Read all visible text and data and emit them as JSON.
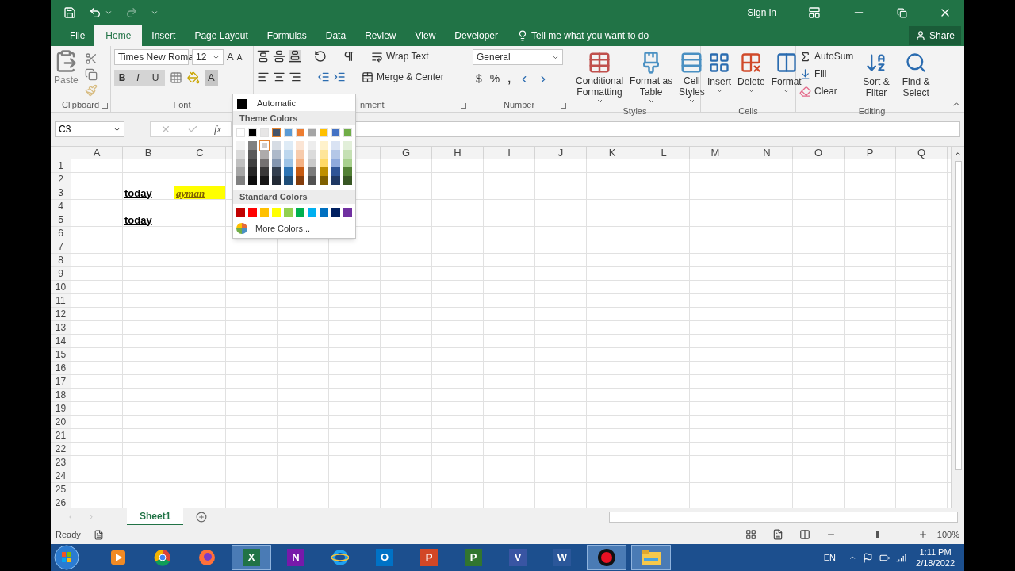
{
  "title_bar": {
    "sign_in": "Sign in"
  },
  "tabs": [
    {
      "label": "File",
      "selected": false
    },
    {
      "label": "Home",
      "selected": true
    },
    {
      "label": "Insert",
      "selected": false
    },
    {
      "label": "Page Layout",
      "selected": false
    },
    {
      "label": "Formulas",
      "selected": false
    },
    {
      "label": "Data",
      "selected": false
    },
    {
      "label": "Review",
      "selected": false
    },
    {
      "label": "View",
      "selected": false
    },
    {
      "label": "Developer",
      "selected": false
    }
  ],
  "tell_me": "Tell me what you want to do",
  "share": "Share",
  "ribbon": {
    "clipboard": {
      "paste": "Paste",
      "label": "Clipboard"
    },
    "font": {
      "font_name": "Times New Roma",
      "font_size": "12",
      "grow": "A",
      "shrink": "A",
      "bold": "B",
      "italic": "I",
      "underline": "U",
      "font_color": "A",
      "font_color_open": true,
      "label": "Font"
    },
    "alignment": {
      "wrap_text": "Wrap Text",
      "merge": "Merge & Center",
      "label": "nment"
    },
    "number": {
      "format": "General",
      "currency": "$",
      "percent": "%",
      "comma": ",",
      "label": "Number"
    },
    "styles": {
      "items": [
        {
          "lines": [
            "Conditional",
            "Formatting"
          ]
        },
        {
          "lines": [
            "Format as",
            "Table"
          ]
        },
        {
          "lines": [
            "Cell",
            "Styles"
          ]
        }
      ],
      "label": "Styles"
    },
    "cells": {
      "items": [
        "Insert",
        "Delete",
        "Format"
      ],
      "label": "Cells"
    },
    "editing": {
      "autosum": "AutoSum",
      "fill": "Fill",
      "clear": "Clear",
      "sort": [
        "Sort &",
        "Filter"
      ],
      "find": [
        "Find &",
        "Select"
      ],
      "label": "Editing"
    }
  },
  "formula_bar": {
    "name_box": "C3",
    "fx": "fx"
  },
  "sheet": {
    "columns": [
      "A",
      "B",
      "C",
      null,
      null,
      null,
      "G",
      "H",
      "I",
      "J",
      "K",
      "L",
      "M",
      "N",
      "O",
      "P",
      "Q"
    ],
    "rows": [
      {
        "label": "1",
        "cells": []
      },
      {
        "label": "2",
        "cells": []
      },
      {
        "label": "3",
        "cells": [
          "",
          {
            "text": "today",
            "serif": false,
            "bold": true,
            "italic": false,
            "underline": true,
            "highlight": false
          },
          {
            "text": "ayman",
            "serif": true,
            "bold": true,
            "italic": true,
            "underline": true,
            "highlight": true
          }
        ]
      },
      {
        "label": "4",
        "cells": []
      },
      {
        "label": "5",
        "cells": [
          "",
          {
            "text": "today",
            "serif": false,
            "bold": true,
            "italic": false,
            "underline": true,
            "highlight": false
          }
        ]
      },
      {
        "label": "6",
        "cells": []
      },
      {
        "label": "7",
        "cells": []
      },
      {
        "label": "8",
        "cells": []
      },
      {
        "label": "9",
        "cells": []
      },
      {
        "label": "10",
        "cells": []
      },
      {
        "label": "11",
        "cells": []
      },
      {
        "label": "12",
        "cells": []
      },
      {
        "label": "13",
        "cells": []
      },
      {
        "label": "14",
        "cells": []
      },
      {
        "label": "15",
        "cells": []
      },
      {
        "label": "16",
        "cells": []
      },
      {
        "label": "17",
        "cells": []
      },
      {
        "label": "18",
        "cells": []
      },
      {
        "label": "19",
        "cells": []
      },
      {
        "label": "20",
        "cells": []
      },
      {
        "label": "21",
        "cells": []
      },
      {
        "label": "22",
        "cells": []
      },
      {
        "label": "23",
        "cells": []
      },
      {
        "label": "24",
        "cells": []
      },
      {
        "label": "25",
        "cells": []
      },
      {
        "label": "26",
        "cells": []
      }
    ]
  },
  "color_menu": {
    "automatic": "Automatic",
    "theme_heading": "Theme Colors",
    "standard_heading": "Standard Colors",
    "more": "More Colors...",
    "theme": [
      {
        "color": "#ffffff",
        "selected": false,
        "shades": [
          {
            "color": "#f2f2f2",
            "selected": false
          },
          {
            "color": "#d9d9d9",
            "selected": false
          },
          {
            "color": "#bfbfbf",
            "selected": false
          },
          {
            "color": "#a6a6a6",
            "selected": false
          },
          {
            "color": "#808080",
            "selected": false
          }
        ]
      },
      {
        "color": "#000000",
        "selected": false,
        "shades": [
          {
            "color": "#808080",
            "selected": false
          },
          {
            "color": "#595959",
            "selected": false
          },
          {
            "color": "#404040",
            "selected": false
          },
          {
            "color": "#262626",
            "selected": false
          },
          {
            "color": "#0d0d0d",
            "selected": false
          }
        ]
      },
      {
        "color": "#e7e6e6",
        "selected": false,
        "shades": [
          {
            "color": "#d0cece",
            "selected": true
          },
          {
            "color": "#aeabab",
            "selected": false
          },
          {
            "color": "#757171",
            "selected": false
          },
          {
            "color": "#3a3838",
            "selected": false
          },
          {
            "color": "#171616",
            "selected": false
          }
        ]
      },
      {
        "color": "#44546a",
        "selected": true,
        "shades": [
          {
            "color": "#d6dce4",
            "selected": false
          },
          {
            "color": "#adb9ca",
            "selected": false
          },
          {
            "color": "#8496b0",
            "selected": false
          },
          {
            "color": "#333f4f",
            "selected": false
          },
          {
            "color": "#222a35",
            "selected": false
          }
        ]
      },
      {
        "color": "#5b9bd5",
        "selected": false,
        "shades": [
          {
            "color": "#deebf6",
            "selected": false
          },
          {
            "color": "#bdd7ee",
            "selected": false
          },
          {
            "color": "#9dc3e6",
            "selected": false
          },
          {
            "color": "#2e75b5",
            "selected": false
          },
          {
            "color": "#1f4e79",
            "selected": false
          }
        ]
      },
      {
        "color": "#ed7d31",
        "selected": false,
        "shades": [
          {
            "color": "#fbe5d5",
            "selected": false
          },
          {
            "color": "#f7cbac",
            "selected": false
          },
          {
            "color": "#f4b183",
            "selected": false
          },
          {
            "color": "#c55a11",
            "selected": false
          },
          {
            "color": "#833c0b",
            "selected": false
          }
        ]
      },
      {
        "color": "#a5a5a5",
        "selected": false,
        "shades": [
          {
            "color": "#ededed",
            "selected": false
          },
          {
            "color": "#dbdbdb",
            "selected": false
          },
          {
            "color": "#c9c9c9",
            "selected": false
          },
          {
            "color": "#7b7b7b",
            "selected": false
          },
          {
            "color": "#525252",
            "selected": false
          }
        ]
      },
      {
        "color": "#ffc000",
        "selected": false,
        "shades": [
          {
            "color": "#fff2cc",
            "selected": false
          },
          {
            "color": "#fee599",
            "selected": false
          },
          {
            "color": "#ffd965",
            "selected": false
          },
          {
            "color": "#bf9000",
            "selected": false
          },
          {
            "color": "#7f6000",
            "selected": false
          }
        ]
      },
      {
        "color": "#4472c4",
        "selected": false,
        "shades": [
          {
            "color": "#dae3f3",
            "selected": false
          },
          {
            "color": "#b4c7e7",
            "selected": false
          },
          {
            "color": "#8faadc",
            "selected": false
          },
          {
            "color": "#2f5496",
            "selected": false
          },
          {
            "color": "#1f3864",
            "selected": false
          }
        ]
      },
      {
        "color": "#70ad47",
        "selected": false,
        "shades": [
          {
            "color": "#e2efd9",
            "selected": false
          },
          {
            "color": "#c5e0b3",
            "selected": false
          },
          {
            "color": "#a8d08d",
            "selected": false
          },
          {
            "color": "#538135",
            "selected": false
          },
          {
            "color": "#375623",
            "selected": false
          }
        ]
      }
    ],
    "standard": [
      {
        "color": "#c00000",
        "selected": false
      },
      {
        "color": "#ff0000",
        "selected": false
      },
      {
        "color": "#ffc000",
        "selected": false
      },
      {
        "color": "#ffff00",
        "selected": false
      },
      {
        "color": "#92d050",
        "selected": false
      },
      {
        "color": "#00b050",
        "selected": false
      },
      {
        "color": "#00b0f0",
        "selected": false
      },
      {
        "color": "#0070c0",
        "selected": false
      },
      {
        "color": "#002060",
        "selected": false
      },
      {
        "color": "#7030a0",
        "selected": false
      }
    ]
  },
  "sheet_tabs": [
    {
      "label": "Sheet1",
      "selected": true
    }
  ],
  "status_bar": {
    "status": "Ready",
    "zoom": "100%",
    "zoom_level": {
      "level": 0.5
    }
  },
  "taskbar": {
    "apps": [
      {
        "kind": "media",
        "color": "#f08a24",
        "active": false
      },
      {
        "kind": "chrome",
        "color": "#4285f4",
        "active": false
      },
      {
        "kind": "firefox",
        "color": "#ff7139",
        "active": false
      },
      {
        "kind": "office",
        "letter": "X",
        "color": "#217346",
        "active": true
      },
      {
        "kind": "office",
        "letter": "N",
        "color": "#7719aa",
        "active": false
      },
      {
        "kind": "ie",
        "color": "#1ea1f1",
        "active": false
      },
      {
        "kind": "office",
        "letter": "O",
        "color": "#0072c6",
        "active": false
      },
      {
        "kind": "office",
        "letter": "P",
        "color": "#d24726",
        "active": false
      },
      {
        "kind": "office",
        "letter": "P",
        "color": "#31752f",
        "active": false
      },
      {
        "kind": "office",
        "letter": "V",
        "color": "#3955a3",
        "active": false
      },
      {
        "kind": "office",
        "letter": "W",
        "color": "#2b579a",
        "active": false
      },
      {
        "kind": "record",
        "color": "#e81123",
        "active": true
      },
      {
        "kind": "folder",
        "color": "#f5c84c",
        "active": true
      }
    ],
    "language": "EN",
    "time": "1:11 PM",
    "date": "2/18/2022"
  }
}
